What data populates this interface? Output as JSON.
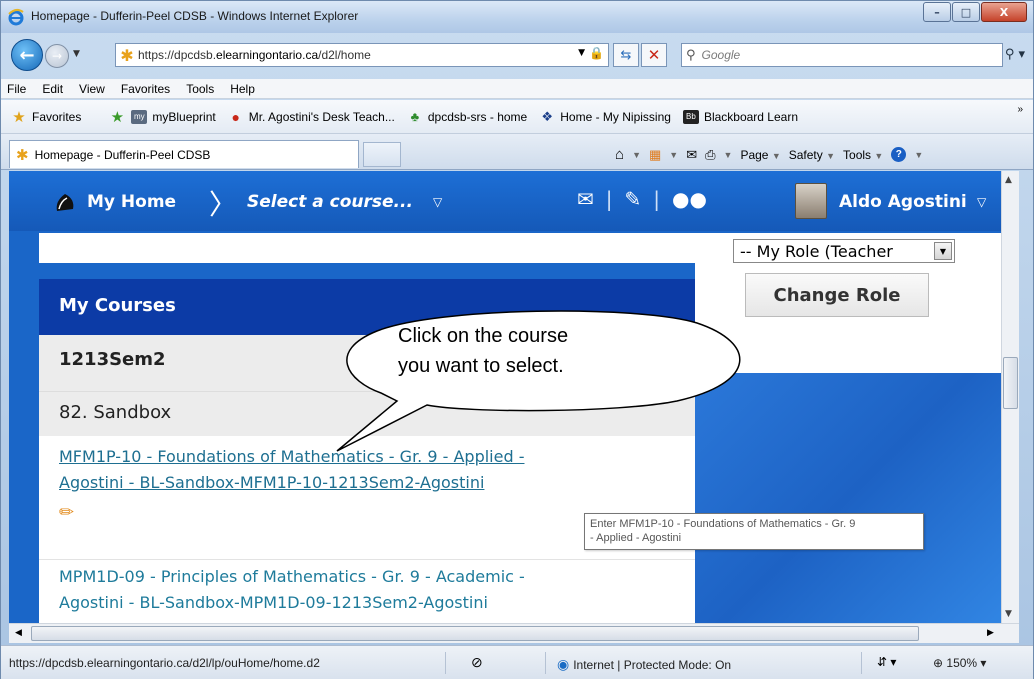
{
  "window": {
    "title": "Homepage - Dufferin-Peel CDSB - Windows Internet Explorer",
    "minimize": "–",
    "maximize": "□",
    "close": "X"
  },
  "address": {
    "url_prefix": "https://dpcdsb.",
    "url_domain": "elearningontario.ca",
    "url_path": "/d2l/home",
    "search_placeholder": "Google"
  },
  "menu": [
    "File",
    "Edit",
    "View",
    "Favorites",
    "Tools",
    "Help"
  ],
  "favorites": {
    "label": "Favorites",
    "items": [
      {
        "label": "myBlueprint",
        "icon": "myblueprint-icon"
      },
      {
        "label": "Mr. Agostini's Desk Teach...",
        "icon": "apple-icon"
      },
      {
        "label": "dpcdsb-srs - home",
        "icon": "plant-icon"
      },
      {
        "label": "Home - My Nipissing",
        "icon": "nipissing-icon"
      },
      {
        "label": "Blackboard Learn",
        "icon": "blackboard-icon"
      }
    ]
  },
  "tab": {
    "label": "Homepage - Dufferin-Peel CDSB"
  },
  "commandbar": {
    "page": "Page",
    "safety": "Safety",
    "tools": "Tools"
  },
  "d2l": {
    "home": "My Home",
    "select_course": "Select a course...",
    "user_name": "Aldo Agostini"
  },
  "courses": {
    "header": "My Courses",
    "semester": "1213Sem2",
    "group": "82. Sandbox",
    "items": [
      {
        "line1": "MFM1P-10 - Foundations of Mathematics - Gr. 9 - Applied -",
        "line2": "Agostini - BL-Sandbox-MFM1P-10-1213Sem2-Agostini"
      },
      {
        "line1": "MPM1D-09 - Principles of Mathematics - Gr. 9 - Academic -",
        "line2": "Agostini - BL-Sandbox-MPM1D-09-1213Sem2-Agostini"
      }
    ]
  },
  "role": {
    "selected": "-- My Role (Teacher",
    "change_button": "Change Role"
  },
  "tooltip": {
    "line1": "Enter MFM1P-10 - Foundations of Mathematics - Gr. 9",
    "line2": "- Applied - Agostini"
  },
  "callout": {
    "line1": "Click on the course",
    "line2": "you want to select."
  },
  "status": {
    "url": "https://dpcdsb.elearningontario.ca/d2l/lp/ouHome/home.d2",
    "zone": "Internet | Protected Mode: On",
    "zoom": "150%"
  },
  "colors": {
    "d2l_nav": "#1d6fd6",
    "courses_header": "#0c3ba6",
    "course_link": "#1e7b9b"
  }
}
